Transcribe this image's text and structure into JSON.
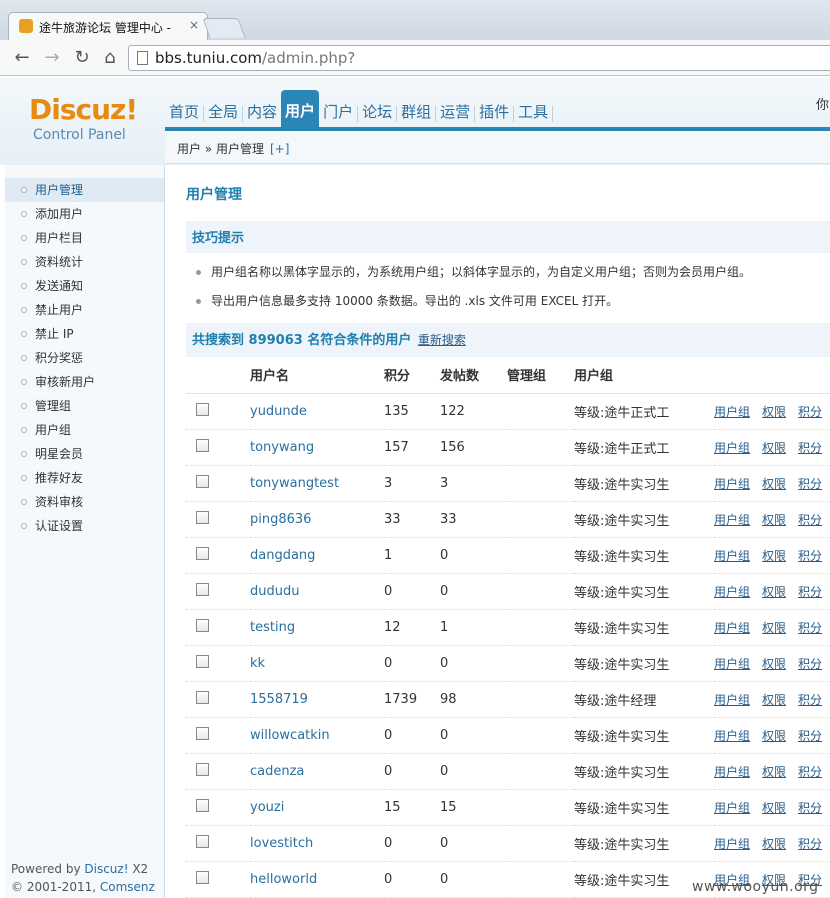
{
  "browser": {
    "tab_title": "途牛旅游论坛 管理中心 -",
    "tab_close": "×",
    "url_host": "bbs.tuniu.com",
    "url_path": "/admin.php?"
  },
  "header": {
    "logo_text": "Discuz!",
    "logo_sub": "Control Panel",
    "nav": [
      "首页",
      "全局",
      "内容",
      "用户",
      "门户",
      "论坛",
      "群组",
      "运营",
      "插件",
      "工具"
    ],
    "right_text": "你",
    "breadcrumb": "用户 » 用户管理",
    "breadcrumb_add": "[+]"
  },
  "sidebar": {
    "items": [
      "用户管理",
      "添加用户",
      "用户栏目",
      "资料统计",
      "发送通知",
      "禁止用户",
      "禁止 IP",
      "积分奖惩",
      "审核新用户",
      "管理组",
      "用户组",
      "明星会员",
      "推荐好友",
      "资料审核",
      "认证设置"
    ],
    "powered_prefix": "Powered by ",
    "powered_link": "Discuz!",
    "powered_version": " X2",
    "copyright_prefix": "© 2001-2011, ",
    "copyright_link": "Comsenz Inc."
  },
  "main": {
    "title": "用户管理",
    "tips_title": "技巧提示",
    "tips": [
      "用户组名称以黑体字显示的，为系统用户组；以斜体字显示的，为自定义用户组；否则为会员用户组。",
      "导出用户信息最多支持 10000 条数据。导出的 .xls 文件可用 EXCEL 打开。"
    ],
    "result_text": "共搜索到 899063 名符合条件的用户",
    "research_link": "重新搜索",
    "columns": [
      "用户名",
      "积分",
      "发帖数",
      "管理组",
      "用户组"
    ],
    "op_links": [
      "用户组",
      "权限",
      "积分"
    ],
    "rows": [
      {
        "name": "yudunde",
        "credits": "135",
        "posts": "122",
        "admin_group": "",
        "group": "等级:途牛正式工"
      },
      {
        "name": "tonywang",
        "credits": "157",
        "posts": "156",
        "admin_group": "",
        "group": "等级:途牛正式工"
      },
      {
        "name": "tonywangtest",
        "credits": "3",
        "posts": "3",
        "admin_group": "",
        "group": "等级:途牛实习生"
      },
      {
        "name": "ping8636",
        "credits": "33",
        "posts": "33",
        "admin_group": "",
        "group": "等级:途牛实习生"
      },
      {
        "name": "dangdang",
        "credits": "1",
        "posts": "0",
        "admin_group": "",
        "group": "等级:途牛实习生"
      },
      {
        "name": "dududu",
        "credits": "0",
        "posts": "0",
        "admin_group": "",
        "group": "等级:途牛实习生"
      },
      {
        "name": "testing",
        "credits": "12",
        "posts": "1",
        "admin_group": "",
        "group": "等级:途牛实习生"
      },
      {
        "name": "kk",
        "credits": "0",
        "posts": "0",
        "admin_group": "",
        "group": "等级:途牛实习生"
      },
      {
        "name": "1558719",
        "credits": "1739",
        "posts": "98",
        "admin_group": "",
        "group": "等级:途牛经理"
      },
      {
        "name": "willowcatkin",
        "credits": "0",
        "posts": "0",
        "admin_group": "",
        "group": "等级:途牛实习生"
      },
      {
        "name": "cadenza",
        "credits": "0",
        "posts": "0",
        "admin_group": "",
        "group": "等级:途牛实习生"
      },
      {
        "name": "youzi",
        "credits": "15",
        "posts": "15",
        "admin_group": "",
        "group": "等级:途牛实习生"
      },
      {
        "name": "lovestitch",
        "credits": "0",
        "posts": "0",
        "admin_group": "",
        "group": "等级:途牛实习生"
      },
      {
        "name": "helloworld",
        "credits": "0",
        "posts": "0",
        "admin_group": "",
        "group": "等级:途牛实习生"
      }
    ]
  },
  "watermark": "www.wooyun.org"
}
